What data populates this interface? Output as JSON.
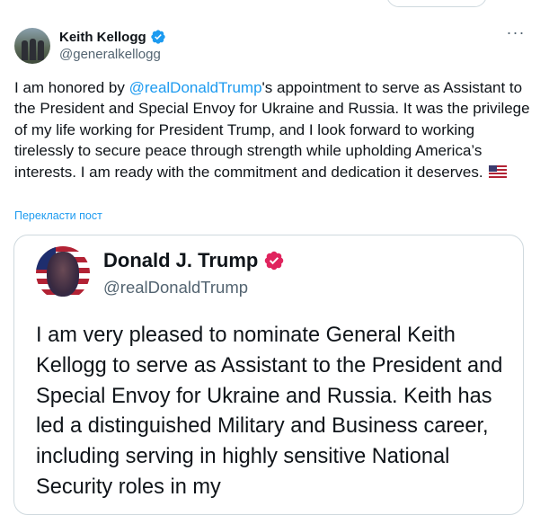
{
  "tweet": {
    "author": {
      "display_name": "Keith Kellogg",
      "handle": "@generalkellogg"
    },
    "text_before": "I am honored by ",
    "mention": "@realDonaldTrump",
    "text_after": "'s appointment to serve as Assistant to the President and Special Envoy for Ukraine and Russia. It was the privilege of my life working for President Trump, and I look forward to working tirelessly to secure peace through strength while upholding America’s interests. I am ready with the commitment and dedication it deserves.",
    "translate_label": "Перекласти пост",
    "more_label": "···"
  },
  "embedded": {
    "display_name": "Donald J. Trump",
    "handle": "@realDonaldTrump",
    "text": "I am very pleased to nominate General Keith Kellogg to serve as Assistant to the President and Special Envoy for Ukraine and Russia. Keith has led a distinguished Military and Business career, including serving in highly sensitive National Security roles in my"
  },
  "colors": {
    "accent": "#1d9bf0",
    "verified_blue": "#1d9bf0",
    "verified_gold": "#e0245e",
    "text": "#0f1419",
    "muted": "#536471"
  },
  "icons": {
    "verified": "verified-badge-icon",
    "more": "more-options-icon",
    "flag": "us-flag-emoji"
  }
}
